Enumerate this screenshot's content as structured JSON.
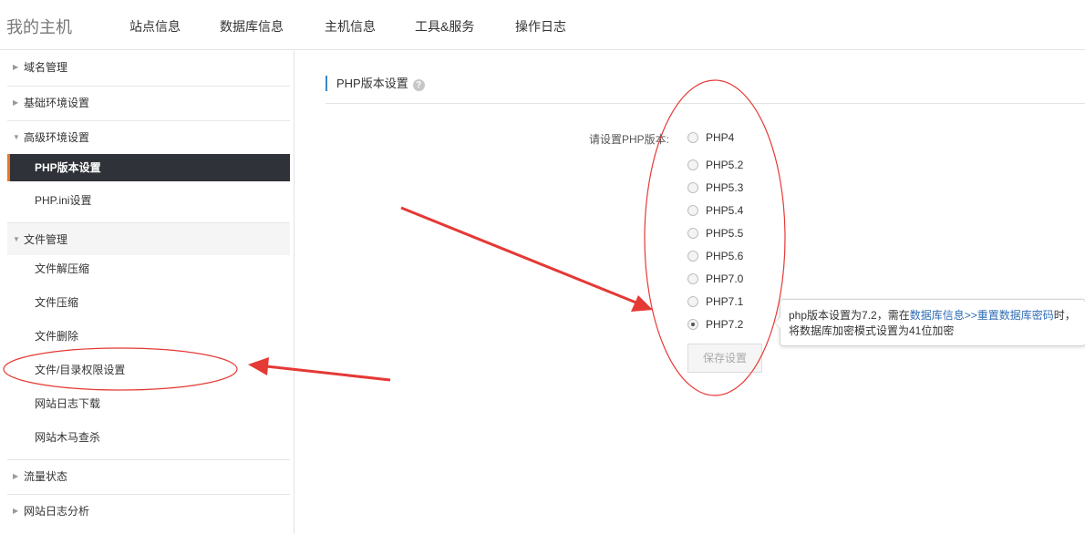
{
  "header": {
    "logo": "我的主机",
    "nav": [
      "站点信息",
      "数据库信息",
      "主机信息",
      "工具&服务",
      "操作日志"
    ]
  },
  "sidebar": {
    "groups": [
      {
        "label": "域名管理"
      },
      {
        "label": "基础环境设置"
      },
      {
        "label": "高级环境设置",
        "items": [
          "PHP版本设置",
          "PHP.ini设置"
        ]
      },
      {
        "label": "文件管理",
        "items": [
          "文件解压缩",
          "文件压缩",
          "文件删除",
          "文件/目录权限设置",
          "网站日志下载",
          "网站木马查杀"
        ]
      },
      {
        "label": "流量状态"
      },
      {
        "label": "网站日志分析"
      }
    ],
    "active_item": "PHP版本设置"
  },
  "main": {
    "section_title": "PHP版本设置",
    "help_icon": "?",
    "form_label": "请设置PHP版本:",
    "options": [
      "PHP4",
      "PHP5.2",
      "PHP5.3",
      "PHP5.4",
      "PHP5.5",
      "PHP5.6",
      "PHP7.0",
      "PHP7.1",
      "PHP7.2"
    ],
    "selected": "PHP7.2",
    "save_button": "保存设置"
  },
  "tooltip": {
    "part1": "php版本设置为7.2，需在",
    "link1": "数据库信息>>重置数据库密码",
    "part2": "时，",
    "line2": "将数据库加密模式设置为41位加密"
  },
  "annotations": {
    "color": "#e53935"
  }
}
